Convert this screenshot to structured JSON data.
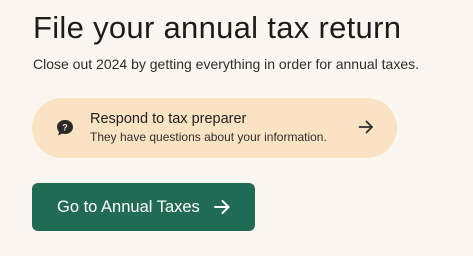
{
  "page": {
    "title": "File your annual tax return",
    "subtitle": "Close out 2024 by getting everything in order for annual taxes."
  },
  "callout": {
    "title": "Respond to tax preparer",
    "description": "They have questions about your information.",
    "icon": "speech-bubble-question-icon",
    "action_icon": "arrow-right-icon",
    "background_color": "#fae3c3"
  },
  "primary_button": {
    "label": "Go to Annual Taxes",
    "icon": "arrow-right-icon",
    "background_color": "#216b54",
    "text_color": "#ffffff"
  },
  "colors": {
    "page_background": "#fbf7f0",
    "text": "#1c1c1c"
  }
}
